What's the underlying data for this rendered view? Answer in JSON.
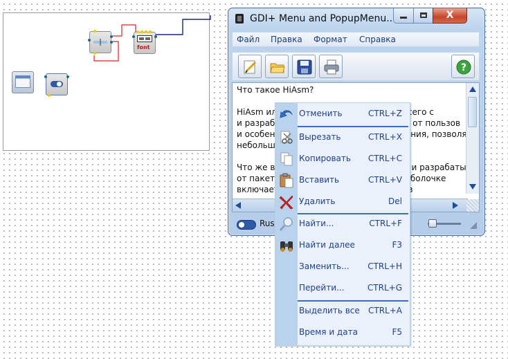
{
  "window": {
    "title": "GDI+ Menu and PopupMenu...",
    "close_glyph": "X"
  },
  "menu_bar": {
    "items": [
      "Файл",
      "Правка",
      "Формат",
      "Справка"
    ]
  },
  "toolbar": {
    "buttons": [
      "pencil-icon",
      "folder-open-icon",
      "save-icon",
      "print-icon",
      "help-icon"
    ],
    "help_glyph": "?"
  },
  "editor": {
    "lines": [
      "Что такое HiAsm?",
      "",
      "HiAsm или HiAsm Studio - это прежде всего с",
      "и разработка программ без каких-либо от пользов",
      "и особенностей языков программирования, позволяющая",
      "небольшой...",
      "",
      "Что же в итоге получает пользователь и разрабатываемые",
      " от пакета: возможность работы его в оболочке",
      " включает в себя набор компонентов, из"
    ]
  },
  "status_bar": {
    "text": "Rus/"
  },
  "canvas": {
    "font_label": "font"
  },
  "popup_menu": {
    "items": [
      {
        "label": "Отменить",
        "shortcut": "CTRL+Z",
        "icon": "undo-icon"
      },
      {
        "label": "Вырезать",
        "shortcut": "CTRL+X",
        "icon": "cut-icon"
      },
      {
        "label": "Копировать",
        "shortcut": "CTRL+C",
        "icon": "copy-icon"
      },
      {
        "label": "Вставить",
        "shortcut": "CTRL+V",
        "icon": "paste-icon"
      },
      {
        "label": "Удалить",
        "shortcut": "Del",
        "icon": "delete-icon"
      },
      {
        "label": "Найти...",
        "shortcut": "CTRL+F",
        "icon": "search-icon"
      },
      {
        "label": "Найти далее",
        "shortcut": "F3",
        "icon": "binoculars-icon"
      },
      {
        "label": "Заменить...",
        "shortcut": "CTRL+H",
        "icon": ""
      },
      {
        "label": "Перейти...",
        "shortcut": "CTRL+G",
        "icon": ""
      },
      {
        "label": "Выделить все",
        "shortcut": "CTRL+A",
        "icon": ""
      },
      {
        "label": "Время и дата",
        "shortcut": "F5",
        "icon": ""
      }
    ]
  },
  "colors": {
    "accent": "#3b6cc2",
    "menu_text": "#1e3f8a",
    "wire_red": "#d42020",
    "wire_blue": "#1a237e"
  }
}
